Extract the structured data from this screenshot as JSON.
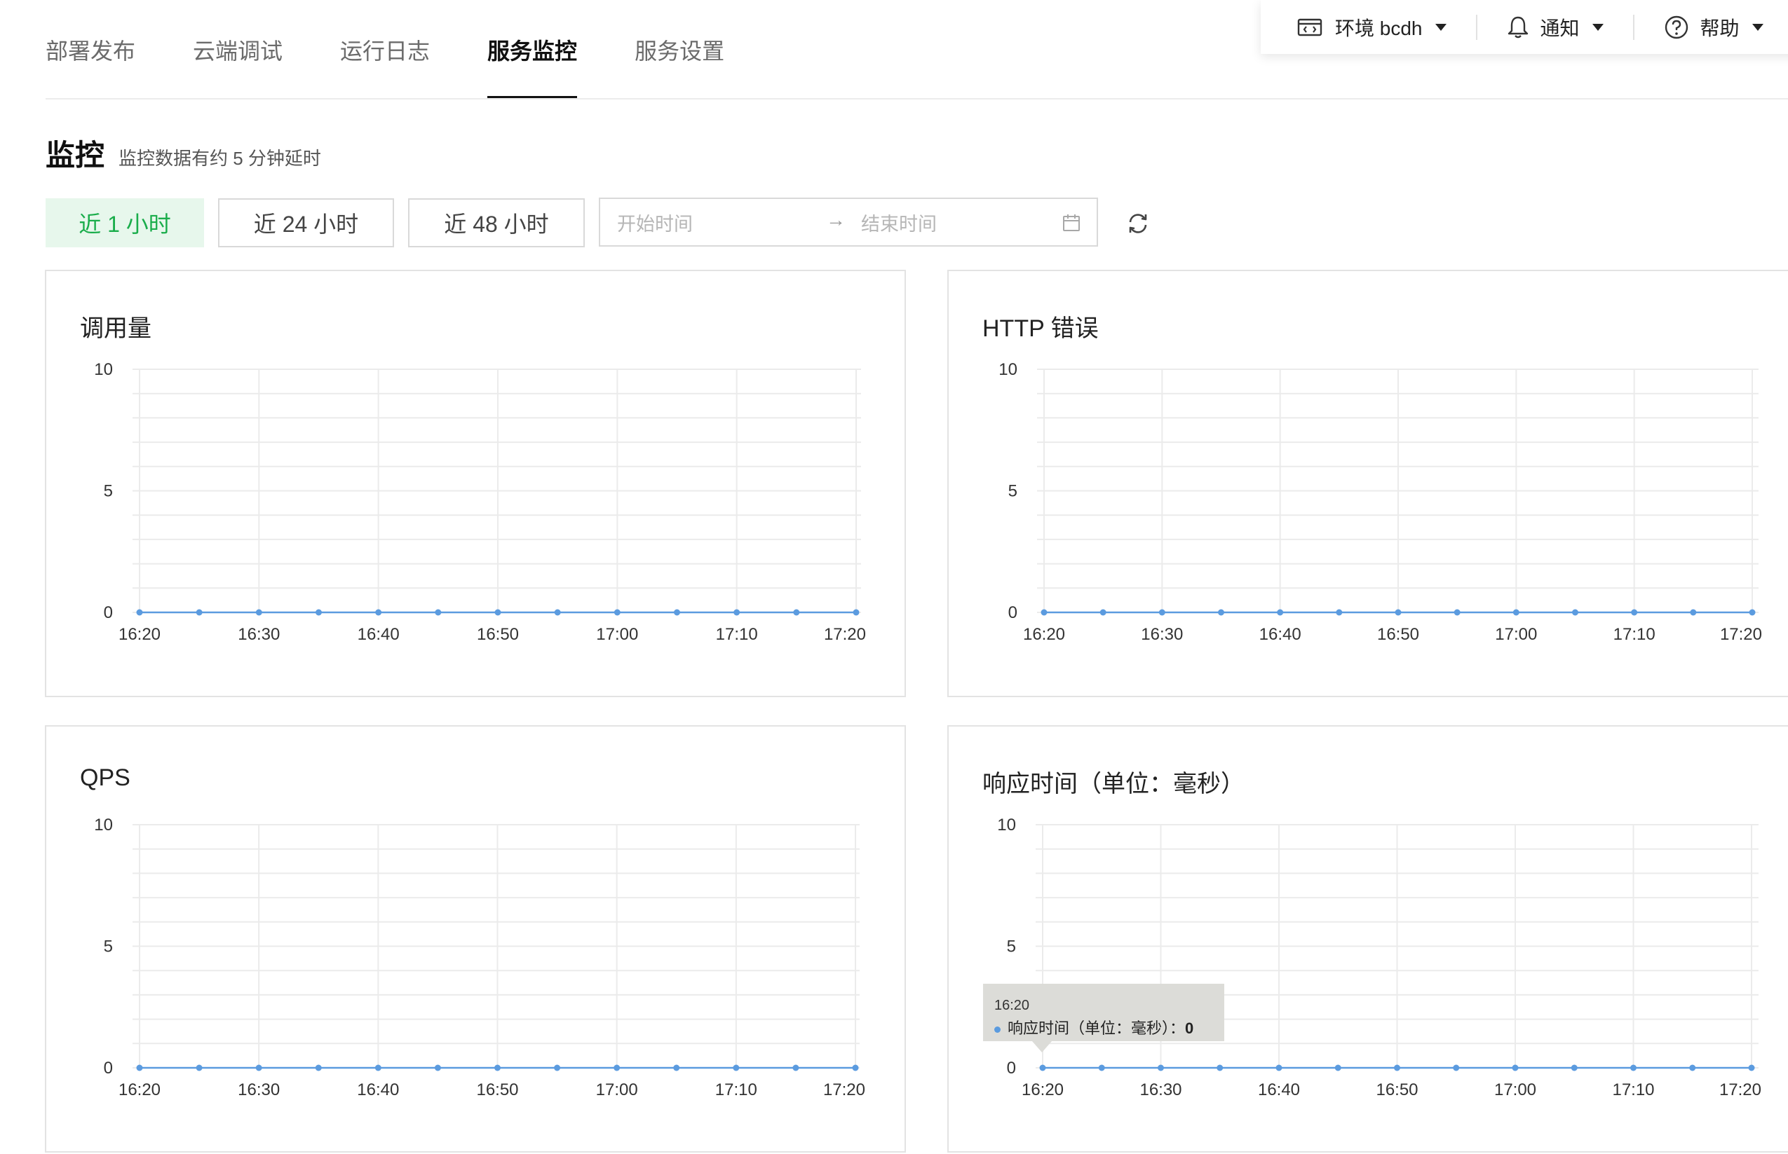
{
  "tabs": [
    {
      "label": "部署发布",
      "active": false
    },
    {
      "label": "云端调试",
      "active": false
    },
    {
      "label": "运行日志",
      "active": false
    },
    {
      "label": "服务监控",
      "active": true
    },
    {
      "label": "服务设置",
      "active": false
    }
  ],
  "toolbar": {
    "env_label": "环境 bcdh",
    "notify_label": "通知",
    "help_label": "帮助"
  },
  "monitor": {
    "title": "监控",
    "subtitle": "监控数据有约 5 分钟延时"
  },
  "ranges": [
    {
      "label": "近 1 小时",
      "active": true
    },
    {
      "label": "近 24 小时",
      "active": false
    },
    {
      "label": "近 48 小时",
      "active": false
    }
  ],
  "date_range": {
    "start_placeholder": "开始时间",
    "arrow": "→",
    "end_placeholder": "结束时间"
  },
  "colors": {
    "accent": "#1aad4b",
    "series": "#5b9bdf",
    "grid": "#ebebeb"
  },
  "chart_data": [
    {
      "type": "line",
      "title": "调用量",
      "x": [
        "16:20",
        "16:25",
        "16:30",
        "16:35",
        "16:40",
        "16:45",
        "16:50",
        "16:55",
        "17:00",
        "17:05",
        "17:10",
        "17:15",
        "17:20"
      ],
      "x_tick_labels": [
        "16:20",
        "16:30",
        "16:40",
        "16:50",
        "17:00",
        "17:10",
        "17:20"
      ],
      "y_ticks": [
        "0",
        "5",
        "10"
      ],
      "values": [
        0,
        0,
        0,
        0,
        0,
        0,
        0,
        0,
        0,
        0,
        0,
        0,
        0
      ],
      "ylim": [
        0,
        10
      ],
      "grid": true
    },
    {
      "type": "line",
      "title": "HTTP 错误",
      "x": [
        "16:20",
        "16:25",
        "16:30",
        "16:35",
        "16:40",
        "16:45",
        "16:50",
        "16:55",
        "17:00",
        "17:05",
        "17:10",
        "17:15",
        "17:20"
      ],
      "x_tick_labels": [
        "16:20",
        "16:30",
        "16:40",
        "16:50",
        "17:00",
        "17:10",
        "17:20"
      ],
      "y_ticks": [
        "0",
        "5",
        "10"
      ],
      "values": [
        0,
        0,
        0,
        0,
        0,
        0,
        0,
        0,
        0,
        0,
        0,
        0,
        0
      ],
      "ylim": [
        0,
        10
      ],
      "grid": true
    },
    {
      "type": "line",
      "title": "QPS",
      "x": [
        "16:20",
        "16:25",
        "16:30",
        "16:35",
        "16:40",
        "16:45",
        "16:50",
        "16:55",
        "17:00",
        "17:05",
        "17:10",
        "17:15",
        "17:20"
      ],
      "x_tick_labels": [
        "16:20",
        "16:30",
        "16:40",
        "16:50",
        "17:00",
        "17:10",
        "17:20"
      ],
      "y_ticks": [
        "0",
        "5",
        "10"
      ],
      "values": [
        0,
        0,
        0,
        0,
        0,
        0,
        0,
        0,
        0,
        0,
        0,
        0,
        0
      ],
      "ylim": [
        0,
        10
      ],
      "grid": true
    },
    {
      "type": "line",
      "title": "响应时间（单位：毫秒）",
      "x": [
        "16:20",
        "16:25",
        "16:30",
        "16:35",
        "16:40",
        "16:45",
        "16:50",
        "16:55",
        "17:00",
        "17:05",
        "17:10",
        "17:15",
        "17:20"
      ],
      "x_tick_labels": [
        "16:20",
        "16:30",
        "16:40",
        "16:50",
        "17:00",
        "17:10",
        "17:20"
      ],
      "y_ticks": [
        "0",
        "5",
        "10"
      ],
      "values": [
        0,
        0,
        0,
        0,
        0,
        0,
        0,
        0,
        0,
        0,
        0,
        0,
        0
      ],
      "ylim": [
        0,
        10
      ],
      "grid": true,
      "tooltip": {
        "time": "16:20",
        "series": "响应时间（单位：毫秒）",
        "sep": "：",
        "value": "0"
      }
    }
  ]
}
